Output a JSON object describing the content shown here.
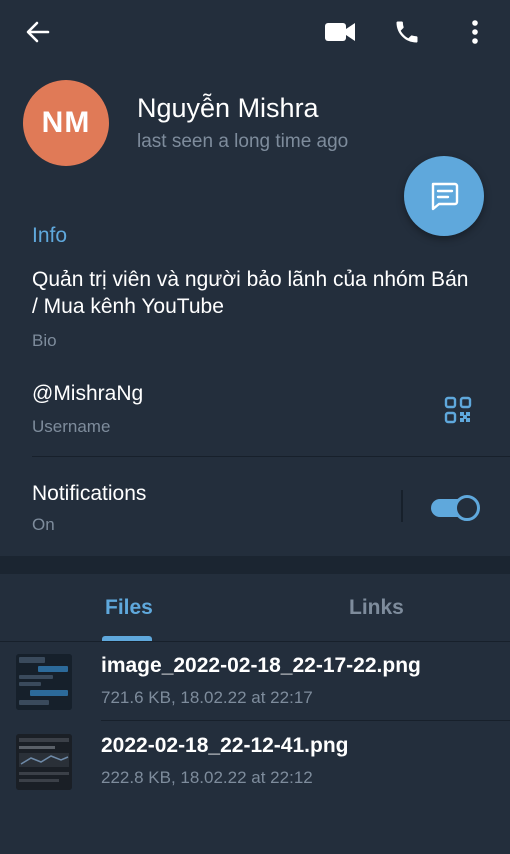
{
  "topbar": {
    "back_icon": "arrow-left-icon",
    "video_icon": "video-camera-icon",
    "call_icon": "phone-icon",
    "more_icon": "more-vertical-icon"
  },
  "profile": {
    "initials": "NM",
    "name": "Nguyễn Mishra",
    "status": "last seen a long time ago",
    "avatar_color": "#e07a57"
  },
  "fab": {
    "icon": "message-icon"
  },
  "info": {
    "title": "Info",
    "bio": "Quản trị viên và người bảo lãnh của nhóm Bán / Mua kênh YouTube",
    "bio_label": "Bio",
    "username": "@MishraNg",
    "username_label": "Username",
    "qr_icon": "qr-code-icon",
    "notifications_title": "Notifications",
    "notifications_state": "On",
    "notifications_enabled": true
  },
  "media_tabs": [
    {
      "label": "Files",
      "active": true
    },
    {
      "label": "Links",
      "active": false
    }
  ],
  "files": [
    {
      "name": "image_2022-02-18_22-17-22.png",
      "meta": "721.6 KB, 18.02.22 at 22:17"
    },
    {
      "name": "2022-02-18_22-12-41.png",
      "meta": "222.8 KB, 18.02.22 at 22:12"
    }
  ],
  "colors": {
    "accent": "#5fa8dc",
    "background": "#232e3c",
    "secondary_text": "#7e8c9c"
  }
}
